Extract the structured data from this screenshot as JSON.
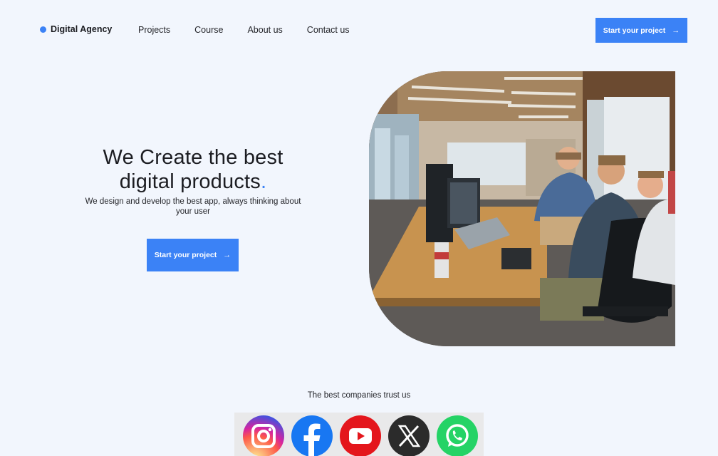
{
  "brand": {
    "name": "Digital Agency",
    "dot_color": "#3b82f6"
  },
  "nav": {
    "links": [
      "Projects",
      "Course",
      "About us",
      "Contact us"
    ]
  },
  "header_cta": {
    "label": "Start your project",
    "arrow": "→"
  },
  "hero": {
    "title_line1": "We Create the best",
    "title_line2": "digital products",
    "title_dot": ".",
    "subtitle": "We design and develop the best app, always thinking about your user",
    "cta_label": "Start your project",
    "cta_arrow": "→"
  },
  "photo": {
    "subject": "team working at desks in open office"
  },
  "trust": {
    "title": "The best companies trust us",
    "logos": [
      "instagram-icon",
      "facebook-icon",
      "youtube-icon",
      "x-icon",
      "whatsapp-icon"
    ]
  },
  "colors": {
    "accent": "#3b82f6",
    "background": "#f2f6fd"
  }
}
